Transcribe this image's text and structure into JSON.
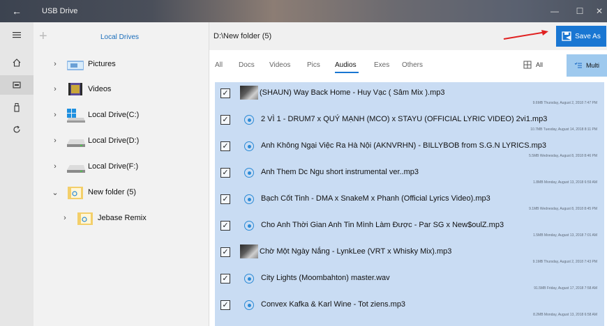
{
  "window": {
    "title": "USB Drive",
    "controls": [
      "—",
      "☐",
      "✕"
    ]
  },
  "rail": {
    "items": [
      "menu-icon",
      "home-icon",
      "drive-icon",
      "usb-icon",
      "sync-icon"
    ]
  },
  "tree": {
    "header_label": "Local Drives",
    "items": [
      {
        "label": "Pictures",
        "icon": "pictures-folder-icon",
        "chevron": "›"
      },
      {
        "label": "Videos",
        "icon": "videos-folder-icon",
        "chevron": "›"
      },
      {
        "label": "Local Drive(C:)",
        "icon": "windows-drive-icon",
        "chevron": "›"
      },
      {
        "label": "Local Drive(D:)",
        "icon": "drive-icon",
        "chevron": "›"
      },
      {
        "label": "Local Drive(F:)",
        "icon": "drive-icon",
        "chevron": "›"
      },
      {
        "label": "New folder (5)",
        "icon": "folder-icon",
        "chevron": "⌄"
      },
      {
        "label": "Jebase Remix",
        "icon": "folder-icon",
        "chevron": "›"
      }
    ]
  },
  "main": {
    "path": "D:\\New folder (5)",
    "save_as_label": "Save As",
    "tabs": [
      "All",
      "Docs",
      "Videos",
      "Pics",
      "Audios",
      "Exes",
      "Others"
    ],
    "active_tab": "Audios",
    "all_label": "All",
    "multi_label": "Multi",
    "files": [
      {
        "name": "(SHAUN) Way Back Home - Huy Vạc ( Sâm Mix ).mp3",
        "meta": "9.6MB  Thursday, August 2, 2018 7:47 PM",
        "icon": "album-thumbnail"
      },
      {
        "name": "2 VÌ 1 - DRUM7 x QUÝ MẠNH (MCO) x STAYU (OFFICIAL LYRIC VIDEO) 2vi1.mp3",
        "meta": "10.7MB  Tuesday, August 14, 2018 8:11 PM",
        "icon": "audio-file-icon"
      },
      {
        "name": "Anh Không Ngại Việc Ra Hà Nội (AKNVRHN) - BILLYBOB from S.G.N  LYRICS.mp3",
        "meta": "5.5MB  Wednesday, August 8, 2018 8:46 PM",
        "icon": "audio-file-icon"
      },
      {
        "name": "Anh Them Dc Ngu short instrumental ver..mp3",
        "meta": "1.8MB  Monday, August 13, 2018 6:59 AM",
        "icon": "audio-file-icon"
      },
      {
        "name": "Bạch Cốt Tinh - DMA x SnakeM x Phanh (Official Lyrics Video).mp3",
        "meta": "9.1MB  Wednesday, August 8, 2018 8:45 PM",
        "icon": "audio-file-icon"
      },
      {
        "name": "Cho Anh Thời Gian Anh Tin Mình Làm Được - Par SG x New$oulZ.mp3",
        "meta": "1.5MB  Monday, August 13, 2018 7:01 AM",
        "icon": "audio-file-icon"
      },
      {
        "name": "Chờ Một Ngày Nắng - LynkLee (VRT x Whisky Mix).mp3",
        "meta": "9.1MB  Thursday, August 2, 2018 7:43 PM",
        "icon": "album-thumbnail"
      },
      {
        "name": "City Lights (Moombahton) master.wav",
        "meta": "91.5MB  Friday, August 17, 2018 7:58 AM",
        "icon": "audio-file-icon"
      },
      {
        "name": "Convex Kafka & Karl Wine - Tot ziens.mp3",
        "meta": "8.2MB  Monday, August 13, 2018 6:58 AM",
        "icon": "audio-file-icon"
      }
    ]
  }
}
